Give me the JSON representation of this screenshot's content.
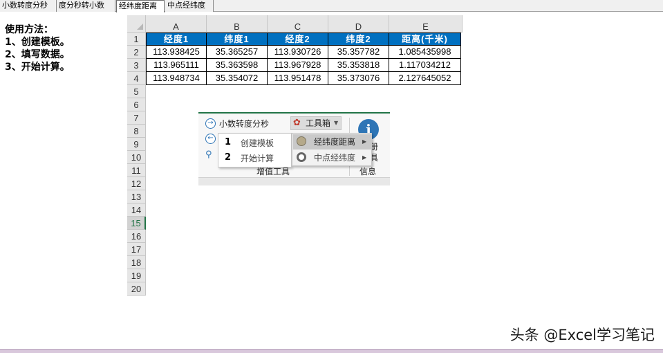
{
  "sheet_tabs": [
    "小数转度分秒",
    "度分秒转小数",
    "经纬度距离",
    "中点经纬度"
  ],
  "active_tab_index": 2,
  "instructions": [
    "使用方法：",
    "1、创建模板。",
    "2、填写数据。",
    "3、开始计算。"
  ],
  "columns": [
    "A",
    "B",
    "C",
    "D",
    "E"
  ],
  "row_numbers": [
    "1",
    "2",
    "3",
    "4",
    "5",
    "6",
    "7",
    "8",
    "9",
    "10",
    "11",
    "12",
    "13",
    "14",
    "15",
    "16",
    "17",
    "18",
    "19",
    "20"
  ],
  "selected_row": "15",
  "table": {
    "header": [
      "经度1",
      "纬度1",
      "经度2",
      "纬度2",
      "距离(千米)"
    ],
    "rows": [
      [
        "113.938425",
        "35.365257",
        "113.930726",
        "35.357782",
        "1.085435998"
      ],
      [
        "113.965111",
        "35.363598",
        "113.967928",
        "35.353818",
        "1.117034212"
      ],
      [
        "113.948734",
        "35.354072",
        "113.951478",
        "35.373076",
        "2.127645052"
      ]
    ],
    "header_color": "#0070c0"
  },
  "ribbon": {
    "top_button": "小数转度分秒",
    "toolbox_button": "工具箱",
    "menu_left": [
      {
        "num": "1",
        "label": "创建模板"
      },
      {
        "num": "2",
        "label": "开始计算"
      }
    ],
    "menu_right": [
      {
        "label": "经纬度距离",
        "highlighted": true
      },
      {
        "label": "中点经纬度",
        "highlighted": false
      }
    ],
    "group_label": "增值工具",
    "info_label": "信息",
    "partial_label_1": "册",
    "partial_label_2": "具",
    "info_icon_glyph": "i"
  },
  "watermark": "头条 @Excel学习笔记",
  "colors": {
    "accent_green": "#217346",
    "header_blue": "#0070c0",
    "icon_blue": "#2e75b6"
  }
}
